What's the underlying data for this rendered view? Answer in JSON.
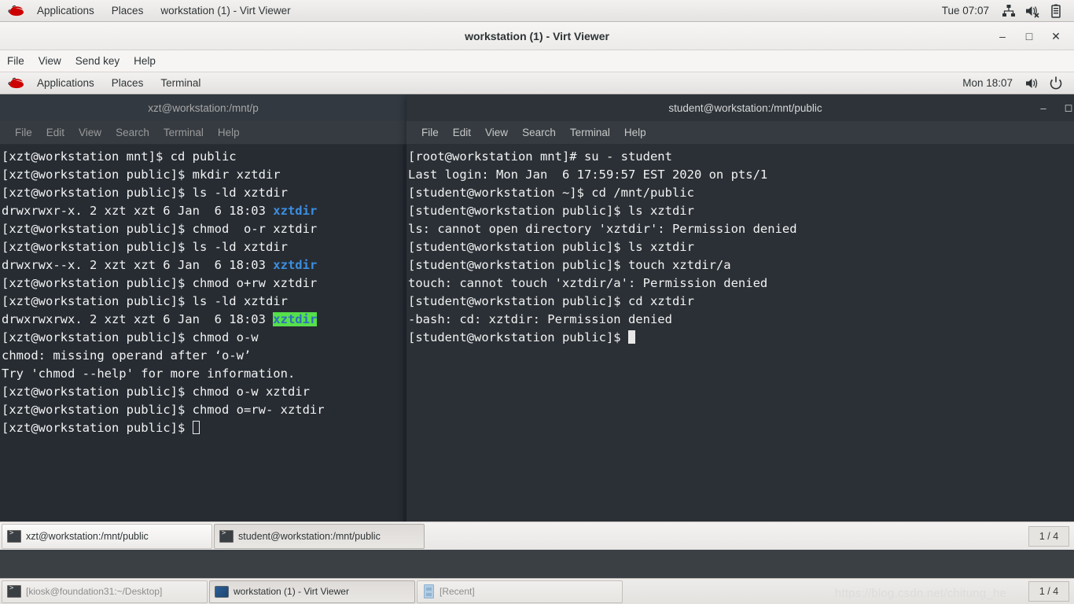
{
  "host": {
    "topbar": {
      "logo": "redhat-logo",
      "applications": "Applications",
      "places": "Places",
      "window_title": "workstation (1) - Virt Viewer",
      "clock": "Tue 07:07",
      "icons": [
        "network-icon",
        "volume-muted-icon",
        "battery-icon"
      ]
    },
    "taskbar": {
      "buttons": [
        {
          "label": "[kiosk@foundation31:~/Desktop]",
          "icon": "terminal-icon",
          "active": false
        },
        {
          "label": "workstation (1) - Virt Viewer",
          "icon": "monitor-icon",
          "active": true
        },
        {
          "label": "[Recent]",
          "icon": "drawer-icon",
          "active": false
        }
      ],
      "workspace": "1 / 4",
      "watermark": "https://blog.csdn.net/chitung_he"
    }
  },
  "virt_viewer": {
    "title": "workstation (1) - Virt Viewer",
    "menus": [
      "File",
      "View",
      "Send key",
      "Help"
    ],
    "window_controls": {
      "minimize": "–",
      "maximize": "□",
      "close": "✕"
    }
  },
  "guest": {
    "topbar": {
      "logo": "redhat-logo",
      "applications": "Applications",
      "places": "Places",
      "terminal": "Terminal",
      "clock": "Mon 18:07",
      "icons": [
        "volume-icon",
        "power-icon"
      ]
    },
    "terminal_menus": [
      "File",
      "Edit",
      "View",
      "Search",
      "Terminal",
      "Help"
    ],
    "left_terminal": {
      "title": "xzt@workstation:/mnt/p",
      "lines": [
        [
          {
            "t": "[xzt@workstation mnt]$ cd public"
          }
        ],
        [
          {
            "t": "[xzt@workstation public]$ mkdir xztdir"
          }
        ],
        [
          {
            "t": "[xzt@workstation public]$ ls -ld xztdir"
          }
        ],
        [
          {
            "t": "drwxrwxr-x. 2 xzt xzt 6 Jan  6 18:03 "
          },
          {
            "t": "xztdir",
            "c": "blue"
          }
        ],
        [
          {
            "t": "[xzt@workstation public]$ chmod  o-r xztdir"
          }
        ],
        [
          {
            "t": "[xzt@workstation public]$ ls -ld xztdir"
          }
        ],
        [
          {
            "t": "drwxrwx--x. 2 xzt xzt 6 Jan  6 18:03 "
          },
          {
            "t": "xztdir",
            "c": "blue"
          }
        ],
        [
          {
            "t": "[xzt@workstation public]$ chmod o+rw xztdir"
          }
        ],
        [
          {
            "t": "[xzt@workstation public]$ ls -ld xztdir"
          }
        ],
        [
          {
            "t": "drwxrwxrwx. 2 xzt xzt 6 Jan  6 18:03 "
          },
          {
            "t": "xztdir",
            "c": "sel-blue"
          }
        ],
        [
          {
            "t": "[xzt@workstation public]$ chmod o-w"
          }
        ],
        [
          {
            "t": "chmod: missing operand after ‘o-w’"
          }
        ],
        [
          {
            "t": "Try 'chmod --help' for more information."
          }
        ],
        [
          {
            "t": "[xzt@workstation public]$ chmod o-w xztdir"
          }
        ],
        [
          {
            "t": "[xzt@workstation public]$ chmod o=rw- xztdir"
          }
        ],
        [
          {
            "t": "[xzt@workstation public]$ "
          },
          {
            "t": "",
            "c": "cursor-box"
          }
        ]
      ]
    },
    "right_terminal": {
      "title": "student@workstation:/mnt/public",
      "lines": [
        [
          {
            "t": "[root@workstation mnt]# su - student"
          }
        ],
        [
          {
            "t": "Last login: Mon Jan  6 17:59:57 EST 2020 on pts/1"
          }
        ],
        [
          {
            "t": "[student@workstation ~]$ cd /mnt/public"
          }
        ],
        [
          {
            "t": "[student@workstation public]$ ls xztdir"
          }
        ],
        [
          {
            "t": "ls: cannot open directory 'xztdir': Permission denied"
          }
        ],
        [
          {
            "t": "[student@workstation public]$ ls xztdir"
          }
        ],
        [
          {
            "t": "[student@workstation public]$ touch xztdir/a"
          }
        ],
        [
          {
            "t": "touch: cannot touch 'xztdir/a': Permission denied"
          }
        ],
        [
          {
            "t": "[student@workstation public]$ cd xztdir"
          }
        ],
        [
          {
            "t": "-bash: cd: xztdir: Permission denied"
          }
        ],
        [
          {
            "t": "[student@workstation public]$ "
          },
          {
            "t": "",
            "c": "cursor-solid"
          }
        ]
      ]
    },
    "taskbar": {
      "buttons": [
        {
          "label": "xzt@workstation:/mnt/public",
          "icon": "terminal-icon",
          "active": false
        },
        {
          "label": "student@workstation:/mnt/public",
          "icon": "terminal-icon",
          "active": true
        }
      ],
      "workspace": "1 / 4"
    }
  }
}
